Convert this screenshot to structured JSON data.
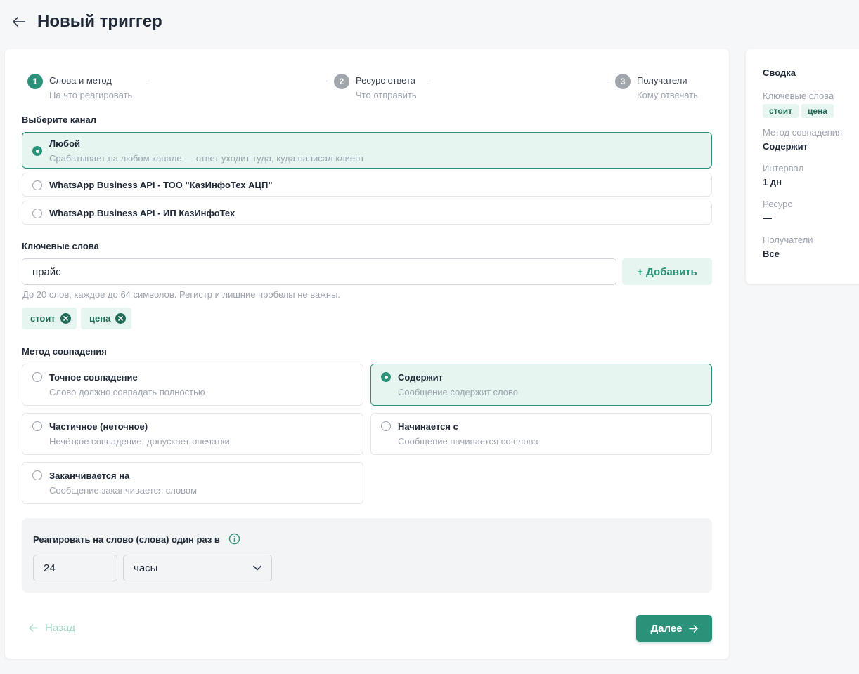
{
  "header": {
    "title": "Новый триггер"
  },
  "stepper": [
    {
      "number": "1",
      "title": "Слова и метод",
      "subtitle": "На что реагировать",
      "state": "active"
    },
    {
      "number": "2",
      "title": "Ресурс ответа",
      "subtitle": "Что отправить",
      "state": "inactive"
    },
    {
      "number": "3",
      "title": "Получатели",
      "subtitle": "Кому отвечать",
      "state": "inactive"
    }
  ],
  "channel": {
    "label": "Выберите канал",
    "options": [
      {
        "title": "Любой",
        "desc": "Срабатывает на любом канале — ответ уходит туда, куда написал клиент",
        "selected": true
      },
      {
        "title": "WhatsApp Business API - ТОО \"КазИнфоТех АЦП\"",
        "selected": false
      },
      {
        "title": "WhatsApp Business API - ИП КазИнфоТех",
        "selected": false
      }
    ]
  },
  "keywords": {
    "label": "Ключевые слова",
    "input_value": "прайс",
    "add_label": "+ Добавить",
    "hint": "До 20 слов, каждое до 64 символов. Регистр и лишние пробелы не важны.",
    "chips": [
      "стоит",
      "цена"
    ]
  },
  "match": {
    "label": "Метод совпадения",
    "options": [
      {
        "title": "Точное совпадение",
        "desc": "Слово должно совпадать полностью",
        "selected": false
      },
      {
        "title": "Содержит",
        "desc": "Сообщение содержит слово",
        "selected": true
      },
      {
        "title": "Частичное (неточное)",
        "desc": "Нечёткое совпадение, допускает опечатки",
        "selected": false
      },
      {
        "title": "Начинается с",
        "desc": "Сообщение начинается со слова",
        "selected": false
      },
      {
        "title": "Заканчивается на",
        "desc": "Сообщение заканчивается словом",
        "selected": false
      }
    ]
  },
  "interval": {
    "label": "Реагировать на слово (слова) один раз в",
    "value": "24",
    "unit": "часы"
  },
  "footer": {
    "back_label": "Назад",
    "next_label": "Далее"
  },
  "summary": {
    "title": "Сводка",
    "keywords_label": "Ключевые слова",
    "keywords": [
      "стоит",
      "цена"
    ],
    "method_label": "Метод совпадения",
    "method_value": "Содержит",
    "interval_label": "Интервал",
    "interval_value": "1 дн",
    "resource_label": "Ресурс",
    "resource_value": "—",
    "recipients_label": "Получатели",
    "recipients_value": "Все"
  },
  "colors": {
    "accent": "#2a9279",
    "accent_light": "#e6f5ef",
    "chip_text": "#1f6b58"
  }
}
